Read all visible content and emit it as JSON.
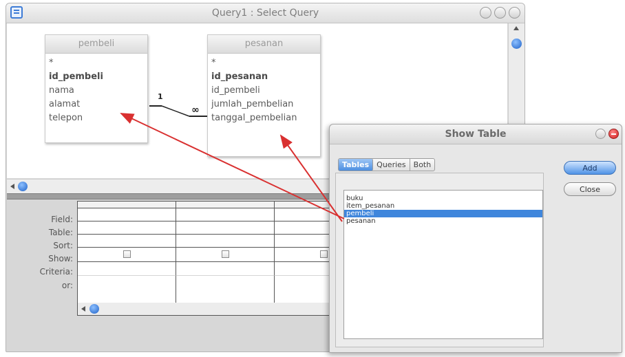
{
  "query_window": {
    "title": "Query1 : Select Query"
  },
  "tables": [
    {
      "name": "pembeli",
      "fields": [
        "*",
        "id_pembeli",
        "nama",
        "alamat",
        "telepon"
      ],
      "key_field": "id_pembeli"
    },
    {
      "name": "pesanan",
      "fields": [
        "*",
        "id_pesanan",
        "id_pembeli",
        "jumlah_pembelian",
        "tanggal_pembelian"
      ],
      "key_field": "id_pesanan"
    }
  ],
  "relationship": {
    "one_symbol": "1",
    "many_symbol": "∞"
  },
  "grid": {
    "row_labels": [
      "Field:",
      "Table:",
      "Sort:",
      "Show:",
      "Criteria:",
      "or:"
    ]
  },
  "show_table": {
    "title": "Show Table",
    "tabs": [
      "Tables",
      "Queries",
      "Both"
    ],
    "active_tab": "Tables",
    "items": [
      "buku",
      "item_pesanan",
      "pembeli",
      "pesanan"
    ],
    "selected_item": "pembeli",
    "add_label": "Add",
    "close_label": "Close"
  },
  "colors": {
    "annotation_arrow": "#d93030",
    "selection": "#3f86dc",
    "accent_blue": "#1f62c8"
  },
  "icons": [
    "query-app-icon",
    "minimize-icon",
    "zoom-icon",
    "close-icon",
    "scroll-up-icon",
    "scroll-left-icon",
    "checkbox-icon"
  ]
}
